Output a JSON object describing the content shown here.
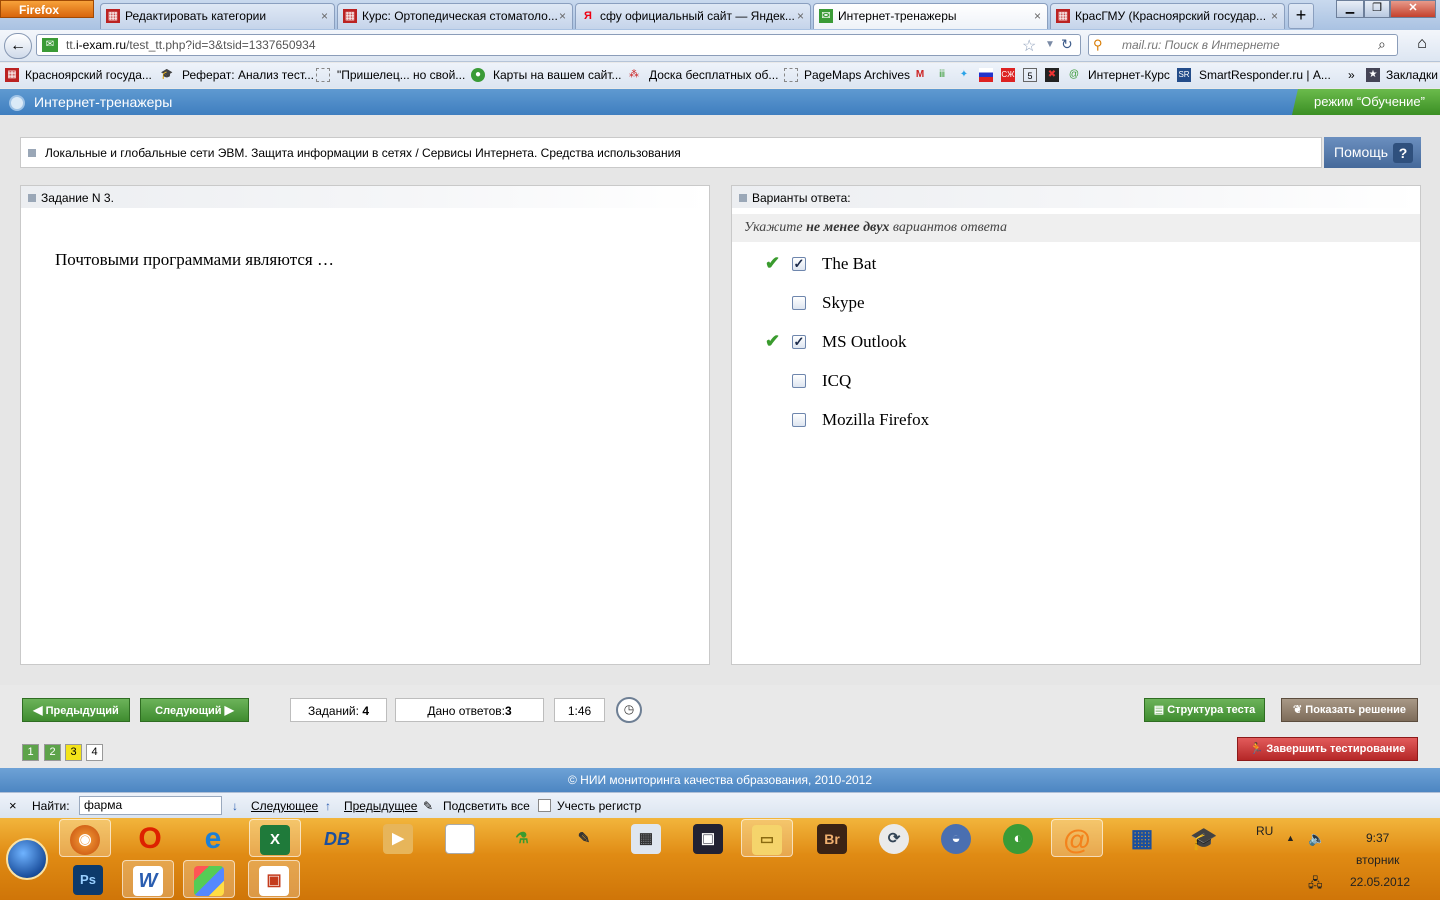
{
  "browser": {
    "menu_button": "Firefox",
    "tabs": [
      {
        "label": "Редактировать категории"
      },
      {
        "label": "Курс: Ортопедическая стоматоло..."
      },
      {
        "label": "сфу официальный сайт — Яндек..."
      },
      {
        "label": "Интернет-тренажеры"
      },
      {
        "label": "КрасГМУ (Красноярский государ..."
      }
    ],
    "new_tab": "+",
    "url_prefix": "tt.",
    "url_domain": "i-exam.ru",
    "url_path": "/test_tt.php?id=3&tsid=1337650934",
    "search_placeholder": "mail.ru: Поиск в Интернете",
    "bookmarks": [
      "Красноярский госуда...",
      "Реферат: Анализ тест...",
      "\"Пришелец... но свой...",
      "Карты на вашем сайт...",
      "Доска бесплатных об...",
      "PageMaps Archives",
      "Интернет-Курс",
      "SmartResponder.ru | А...",
      "Закладки"
    ],
    "bookmarks_overflow": "»"
  },
  "app": {
    "title": "Интернет-тренажеры",
    "mode": "режим “Обучение”",
    "topic": "Локальные и глобальные сети ЭВМ. Защита информации в сетях / Сервисы Интернета. Средства использования",
    "help_label": "Помощь",
    "help_icon": "?",
    "question": {
      "header": "Задание N 3.",
      "text": "Почтовыми программами являются …"
    },
    "answers": {
      "header": "Варианты ответа:",
      "hint_pre": "Укажите ",
      "hint_bold": "не менее двух",
      "hint_post": " вариантов ответа",
      "options": [
        {
          "label": "The Bat",
          "checked": true,
          "correct": true
        },
        {
          "label": "Skype",
          "checked": false,
          "correct": false
        },
        {
          "label": "MS Outlook",
          "checked": true,
          "correct": true
        },
        {
          "label": "ICQ",
          "checked": false,
          "correct": false
        },
        {
          "label": "Mozilla Firefox",
          "checked": false,
          "correct": false
        }
      ]
    },
    "nav": {
      "prev": "Предыдущий",
      "next": "Следующий",
      "tasks_label": "Заданий: ",
      "tasks_value": "4",
      "answered_label": "Дано ответов:",
      "answered_value": "3",
      "timer": "1:46",
      "structure": "Структура теста",
      "show_solution": "Показать решение",
      "finish": "Завершить тестирование",
      "pages": [
        "1",
        "2",
        "3",
        "4"
      ],
      "current_page": "3"
    },
    "footer": "© НИИ мониторинга качества образования, 2010-2012"
  },
  "findbar": {
    "label": "Найти:",
    "value": "фарма",
    "next": "Следующее",
    "prev": "Предыдущее",
    "highlight": "Подсветить все",
    "match_case": "Учесть регистр"
  },
  "taskbar": {
    "lang": "RU",
    "time": "9:37",
    "day": "вторник",
    "date": "22.05.2012",
    "apps": [
      "firefox-icon",
      "opera-icon",
      "ie-icon",
      "excel-icon",
      "dbase-icon",
      "media-icon",
      "notepad-icon",
      "chem-icon",
      "paint-icon",
      "calculator-icon",
      "save-icon",
      "explorer-icon",
      "bridge-icon",
      "tool-icon",
      "cleaner-icon",
      "utility-icon",
      "mail-icon",
      "tiles-icon",
      "graduation-icon",
      "photoshop-icon",
      "word-icon",
      "windows-icon",
      "powerpoint-icon"
    ]
  },
  "colors": {
    "app_header": "#4d86c2",
    "mode_badge": "#4c9f33",
    "correct_check": "#3a9b2e",
    "finish_button": "#c53a3a",
    "green_button": "#4f9e3f"
  }
}
